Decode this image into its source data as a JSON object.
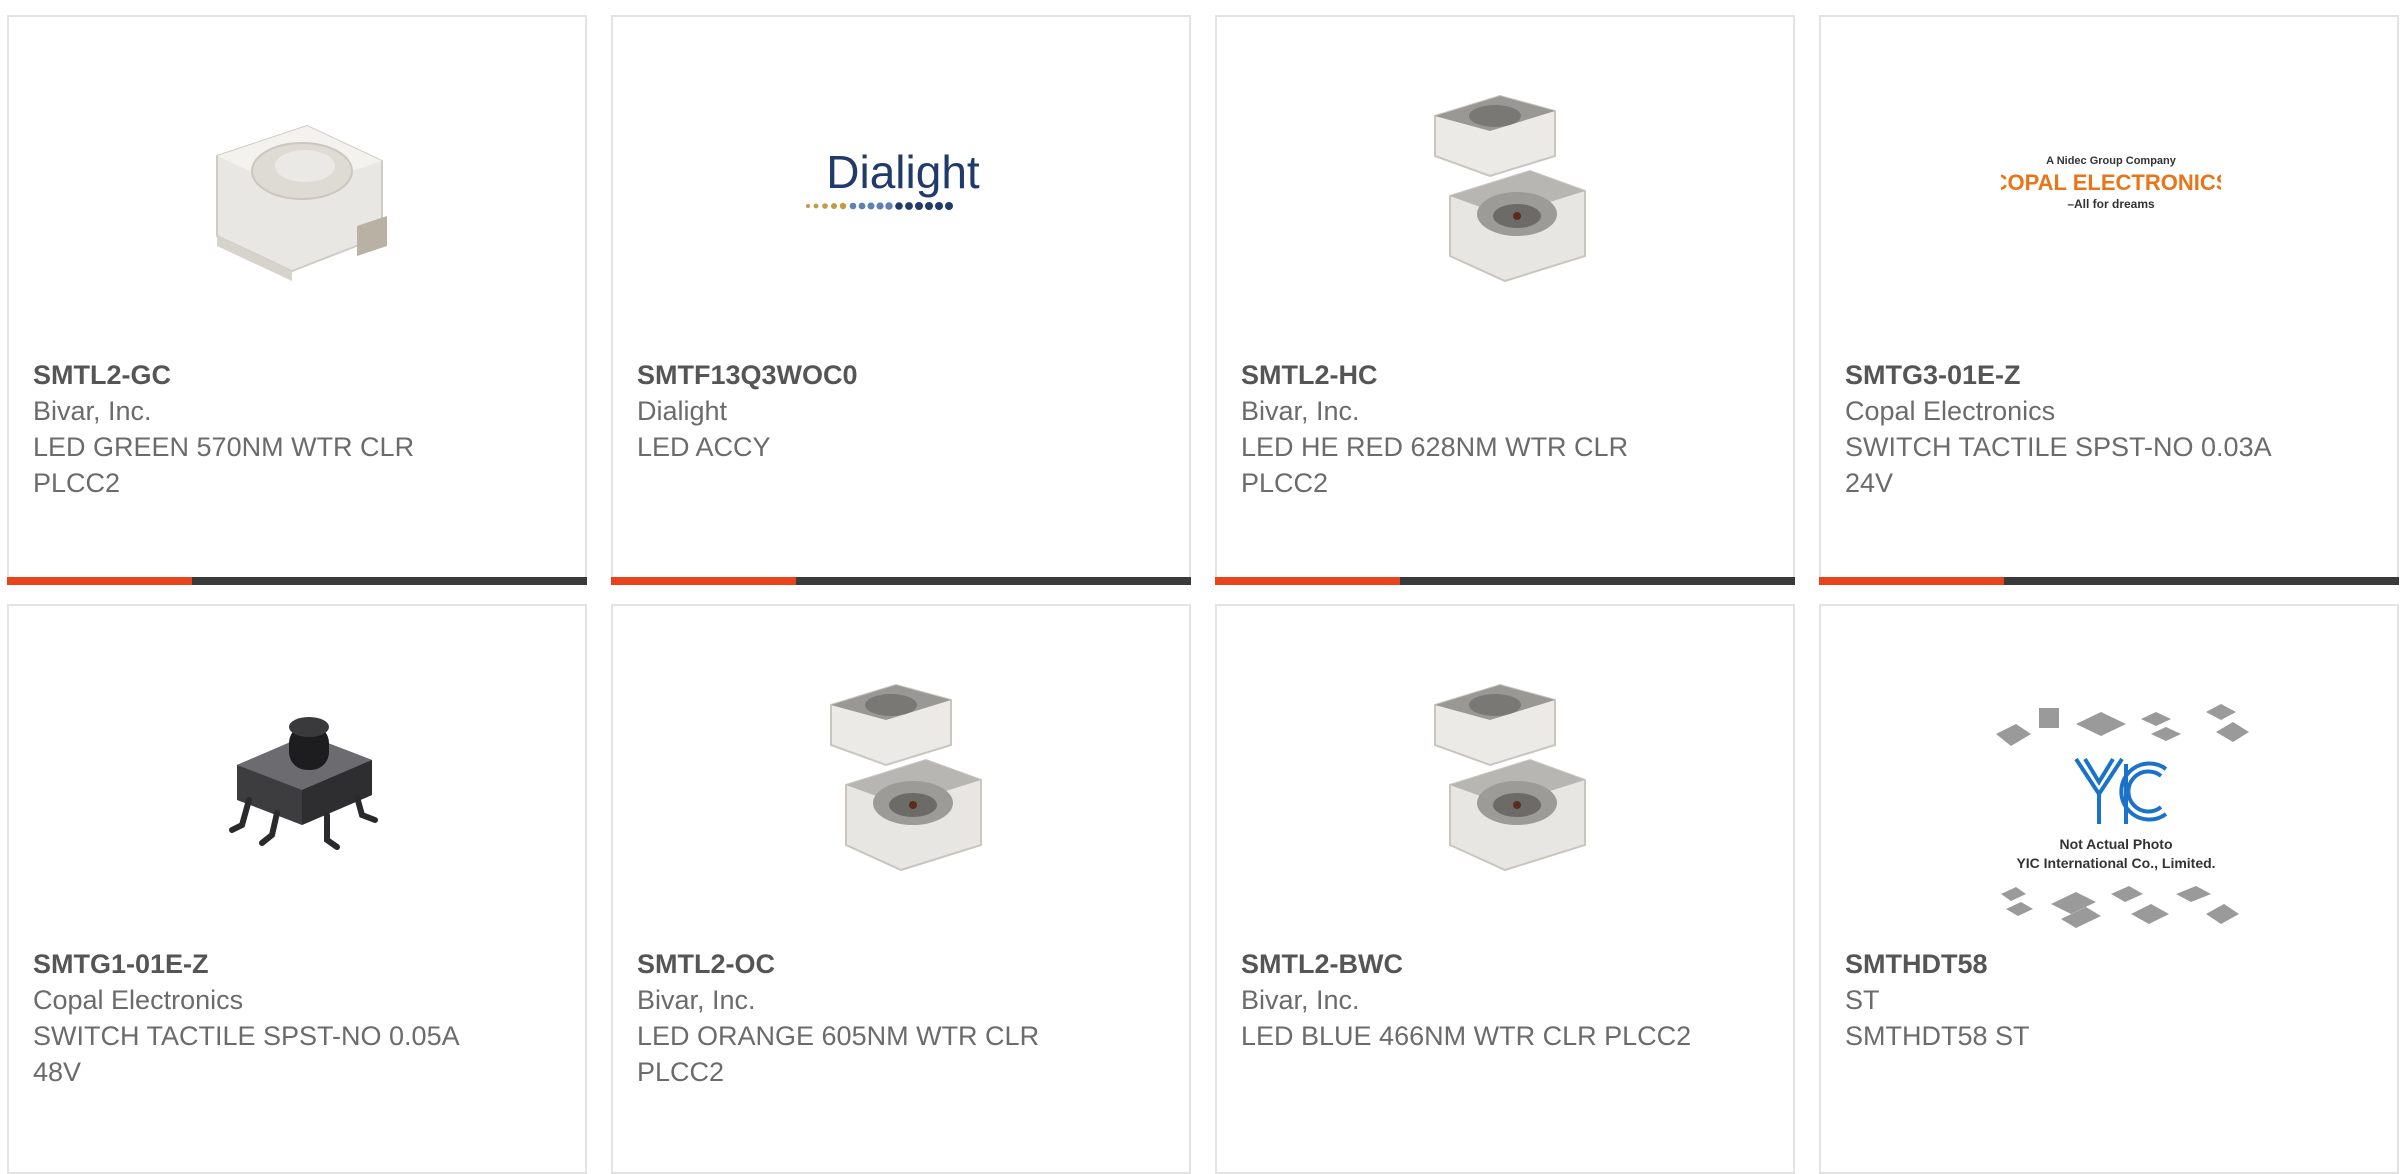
{
  "products": [
    {
      "part_number": "SMTL2-GC",
      "manufacturer": "Bivar, Inc.",
      "description": "LED GREEN 570NM WTR CLR PLCC2",
      "image": "led-white-side-icon"
    },
    {
      "part_number": "SMTF13Q3WOC0",
      "manufacturer": "Dialight",
      "description": "LED ACCY",
      "image": "dialight-logo",
      "logo_text": "Dialight"
    },
    {
      "part_number": "SMTL2-HC",
      "manufacturer": "Bivar, Inc.",
      "description": "LED HE RED 628NM WTR CLR PLCC2",
      "image": "led-stacked-icon"
    },
    {
      "part_number": "SMTG3-01E-Z",
      "manufacturer": "Copal Electronics",
      "description": "SWITCH TACTILE SPST-NO 0.03A 24V",
      "image": "copal-logo",
      "logo_lines": [
        "A Nidec Group Company",
        "COPAL ELECTRONICS",
        "–All for dreams"
      ]
    },
    {
      "part_number": "SMTG1-01E-Z",
      "manufacturer": "Copal Electronics",
      "description": "SWITCH TACTILE SPST-NO 0.05A 48V",
      "image": "tactile-switch-icon"
    },
    {
      "part_number": "SMTL2-OC",
      "manufacturer": "Bivar, Inc.",
      "description": "LED ORANGE 605NM WTR CLR PLCC2",
      "image": "led-stacked-icon"
    },
    {
      "part_number": "SMTL2-BWC",
      "manufacturer": "Bivar, Inc.",
      "description": "LED BLUE 466NM WTR CLR PLCC2",
      "image": "led-stacked-icon"
    },
    {
      "part_number": "SMTHDT58",
      "manufacturer": "ST",
      "description": "SMTHDT58 ST",
      "image": "yic-placeholder-icon",
      "placeholder_lines": [
        "Not Actual Photo",
        "YIC International Co., Limited."
      ]
    }
  ],
  "colors": {
    "accent": "#e8431c",
    "bar": "#3a3a3a",
    "text": "#6b6b6b",
    "border": "#e3e3e3",
    "dialight_blue": "#1f3a6b",
    "copal_orange": "#e8751a",
    "yic_blue": "#1a73c9"
  }
}
